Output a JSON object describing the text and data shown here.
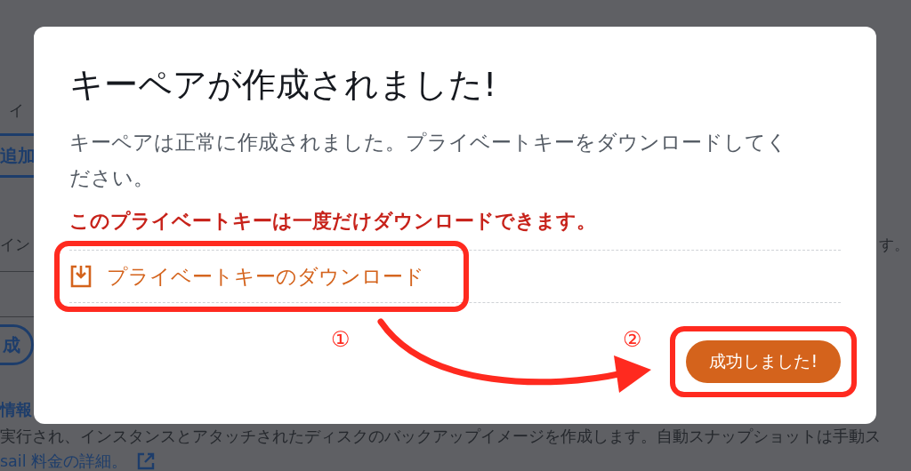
{
  "background": {
    "label": "イ",
    "add_button": "追加",
    "field_label": "イン",
    "field_note": "す。",
    "action_button": "成",
    "section_title": "情報",
    "description": "実行され、インスタンスとアタッチされたディスクのバックアップイメージを作成します。自動スナップショットは手動ス",
    "link": "sail 料金の詳細。"
  },
  "dialog": {
    "title": "キーペアが作成されました!",
    "message": "キーペアは正常に作成されました。プライベートキーをダウンロードしてください。",
    "warning": "このプライベートキーは一度だけダウンロードできます。",
    "download_link": "プライベートキーのダウンロード",
    "confirm_button": "成功しました!"
  },
  "annotations": [
    {
      "number": "①"
    },
    {
      "number": "②"
    }
  ]
}
